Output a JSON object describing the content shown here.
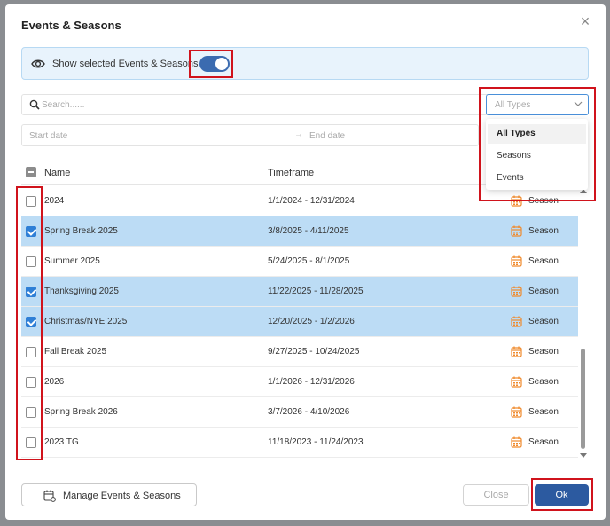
{
  "dialog": {
    "title": "Events & Seasons",
    "close_glyph": "×"
  },
  "banner": {
    "label": "Show selected Events & Seasons",
    "toggle_on": true
  },
  "filters": {
    "search_placeholder": "Search......",
    "start_placeholder": "Start date",
    "arrow": "→",
    "end_placeholder": "End date",
    "type_placeholder": "All Types",
    "type_options": [
      "All Types",
      "Seasons",
      "Events"
    ],
    "selected_type": "All Types"
  },
  "table": {
    "columns": {
      "name": "Name",
      "timeframe": "Timeframe"
    },
    "rows": [
      {
        "name": "2024",
        "timeframe": "1/1/2024 - 12/31/2024",
        "type": "Season",
        "checked": false
      },
      {
        "name": "Spring Break 2025",
        "timeframe": "3/8/2025 - 4/11/2025",
        "type": "Season",
        "checked": true
      },
      {
        "name": "Summer 2025",
        "timeframe": "5/24/2025 - 8/1/2025",
        "type": "Season",
        "checked": false
      },
      {
        "name": "Thanksgiving 2025",
        "timeframe": "11/22/2025 - 11/28/2025",
        "type": "Season",
        "checked": true
      },
      {
        "name": "Christmas/NYE 2025",
        "timeframe": "12/20/2025 - 1/2/2026",
        "type": "Season",
        "checked": true
      },
      {
        "name": "Fall Break 2025",
        "timeframe": "9/27/2025 - 10/24/2025",
        "type": "Season",
        "checked": false
      },
      {
        "name": "2026",
        "timeframe": "1/1/2026 - 12/31/2026",
        "type": "Season",
        "checked": false
      },
      {
        "name": "Spring Break 2026",
        "timeframe": "3/7/2026 - 4/10/2026",
        "type": "Season",
        "checked": false
      },
      {
        "name": "2023 TG",
        "timeframe": "11/18/2023 - 11/24/2023",
        "type": "Season",
        "checked": false
      }
    ]
  },
  "footer": {
    "manage_label": "Manage Events & Seasons",
    "close_label": "Close",
    "ok_label": "Ok"
  },
  "colors": {
    "accent": "#2c5aa0",
    "row_selected": "#bcdcf5",
    "highlight": "#d0131c",
    "calendar_icon": "#f08a2c"
  }
}
